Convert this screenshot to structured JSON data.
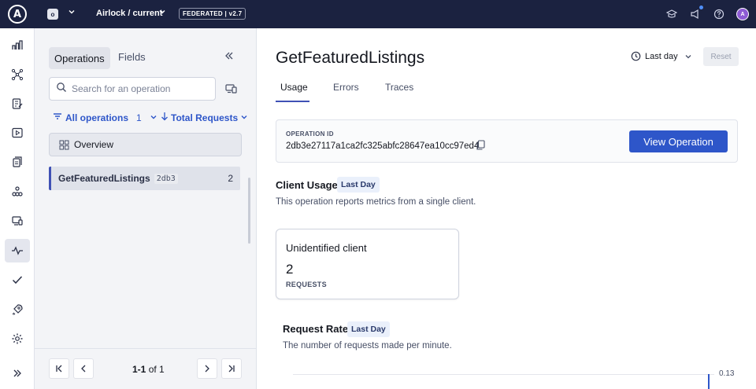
{
  "topbar": {
    "logo_letter": "A",
    "org_badge": "o",
    "graph_name": "Airlock / current",
    "federation_badge": "FEDERATED | v2.7",
    "avatar_initials": "A",
    "icons": [
      "learn-icon",
      "announcements-icon",
      "help-icon",
      "user-avatar"
    ]
  },
  "leftnav": {
    "items": [
      "overview-icon",
      "schema-icon",
      "changelog-icon",
      "explorer-icon",
      "subgraphs-icon",
      "clients-icon",
      "launches-icon",
      "insights-icon",
      "checks-icon",
      "deploy-icon",
      "settings-icon",
      "expand-icon"
    ],
    "active_item": "insights-icon"
  },
  "ops_panel": {
    "tab_operations": "Operations",
    "tab_fields": "Fields",
    "search_placeholder": "Search for an operation",
    "filter_label": "All operations",
    "filter_count": "1",
    "sort_label": "Total Requests",
    "overview_label": "Overview",
    "operations": [
      {
        "name": "GetFeaturedListings",
        "hash": "2db3",
        "count": "2"
      }
    ],
    "pager": {
      "range": "1-1",
      "of_text": "of 1"
    }
  },
  "main": {
    "title": "GetFeaturedListings",
    "time_range": "Last day",
    "reset_label": "Reset",
    "tabs": [
      "Usage",
      "Errors",
      "Traces"
    ],
    "active_tab": "Usage",
    "operation_id_label": "OPERATION ID",
    "operation_id": "2db3e27117a1ca2fc325abfc28647ea10cc97ed4",
    "view_operation_label": "View Operation",
    "client_usage": {
      "title": "Client Usage",
      "tag": "Last Day",
      "description": "This operation reports metrics from a single client.",
      "card": {
        "client": "Unidentified client",
        "value": "2",
        "label": "REQUESTS"
      }
    },
    "request_rate": {
      "title": "Request Rate",
      "tag": "Last Day",
      "description": "The number of requests made per minute.",
      "tick_max": "0.13"
    }
  },
  "colors": {
    "topbar_bg": "#1b2240",
    "accent": "#2e56c9",
    "active_indicator": "#3f51b5"
  }
}
